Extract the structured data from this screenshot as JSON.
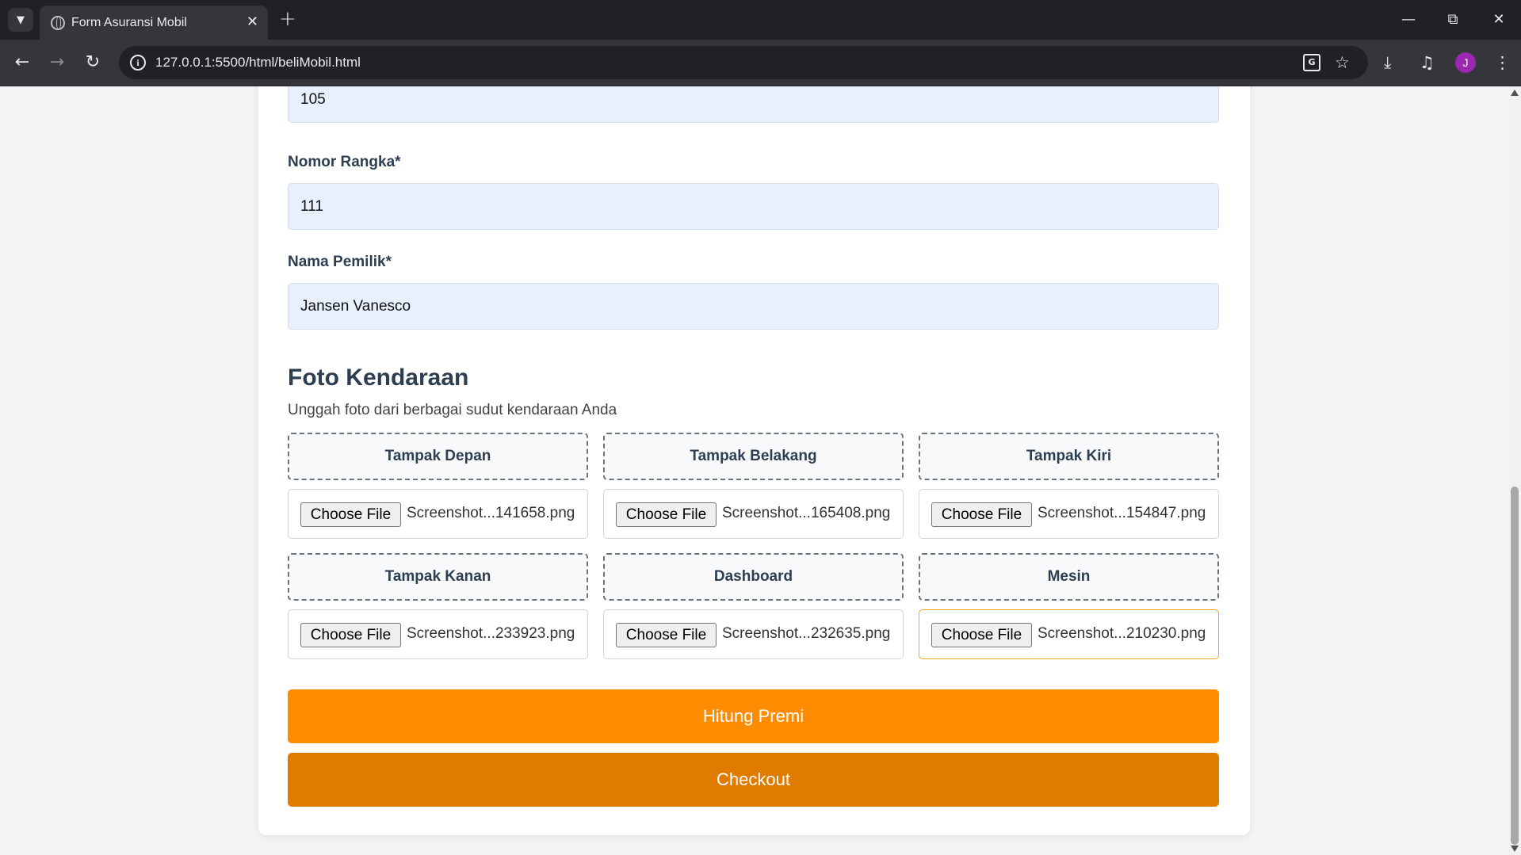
{
  "browser": {
    "tab_title": "Form Asuransi Mobil",
    "url": "127.0.0.1:5500/html/beliMobil.html",
    "profile_initial": "J"
  },
  "form": {
    "engine_number_value": "105",
    "chassis_label": "Nomor Rangka*",
    "chassis_value": "111",
    "owner_label": "Nama Pemilik*",
    "owner_value": "Jansen Vanesco"
  },
  "photos": {
    "title": "Foto Kendaraan",
    "subtitle": "Unggah foto dari berbagai sudut kendaraan Anda",
    "choose_label": "Choose File",
    "items": [
      {
        "label": "Tampak Depan",
        "file": "Screenshot...141658.png"
      },
      {
        "label": "Tampak Belakang",
        "file": "Screenshot...165408.png"
      },
      {
        "label": "Tampak Kiri",
        "file": "Screenshot...154847.png"
      },
      {
        "label": "Tampak Kanan",
        "file": "Screenshot...233923.png"
      },
      {
        "label": "Dashboard",
        "file": "Screenshot...232635.png"
      },
      {
        "label": "Mesin",
        "file": "Screenshot...210230.png"
      }
    ]
  },
  "actions": {
    "calculate_label": "Hitung Premi",
    "checkout_label": "Checkout"
  },
  "colors": {
    "primary_orange": "#ff8c00",
    "dark_orange": "#e07b00",
    "input_bg": "#e8f0fe"
  }
}
